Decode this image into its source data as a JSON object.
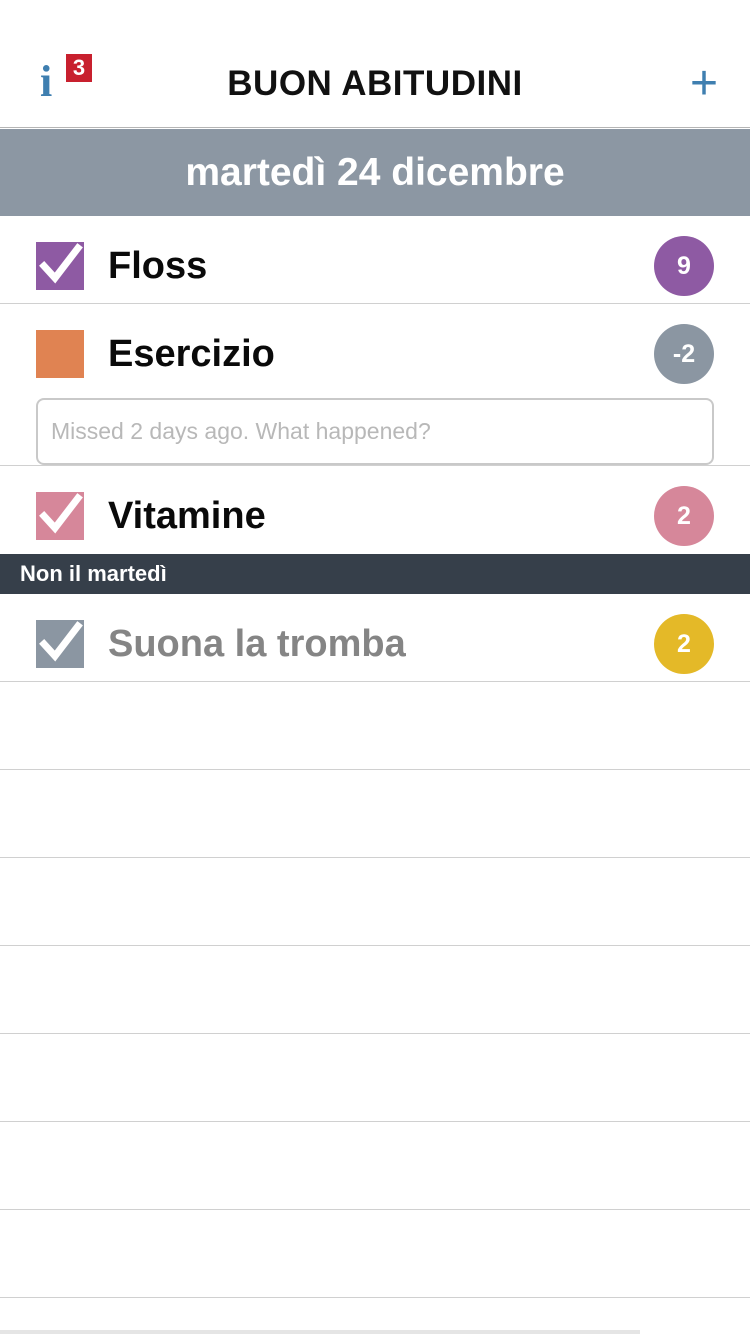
{
  "navbar": {
    "title": "BUON ABITUDINI",
    "info_icon": "info-icon",
    "info_badge": "3",
    "add_label": "+"
  },
  "date_banner": "martedì 24 dicembre",
  "habits": [
    {
      "name": "Floss",
      "checked": true,
      "color": "#8e5aa3",
      "count": "9",
      "count_color": "#8e5aa3"
    },
    {
      "name": "Esercizio",
      "checked": false,
      "color": "#e08352",
      "count": "-2",
      "count_color": "#8b96a2",
      "note_placeholder": "Missed 2 days ago. What happened?"
    },
    {
      "name": "Vitamine",
      "checked": true,
      "color": "#d6879a",
      "count": "2",
      "count_color": "#d6879a"
    }
  ],
  "section": {
    "title": "Non il martedì",
    "habits": [
      {
        "name": "Suona la tromba",
        "checked": true,
        "color": "#8b96a2",
        "count": "2",
        "count_color": "#e4b928"
      }
    ]
  },
  "colors": {
    "accent": "#3f7fb0",
    "banner": "#8c97a3",
    "section_header": "#363f4a",
    "badge": "#c8202e"
  }
}
